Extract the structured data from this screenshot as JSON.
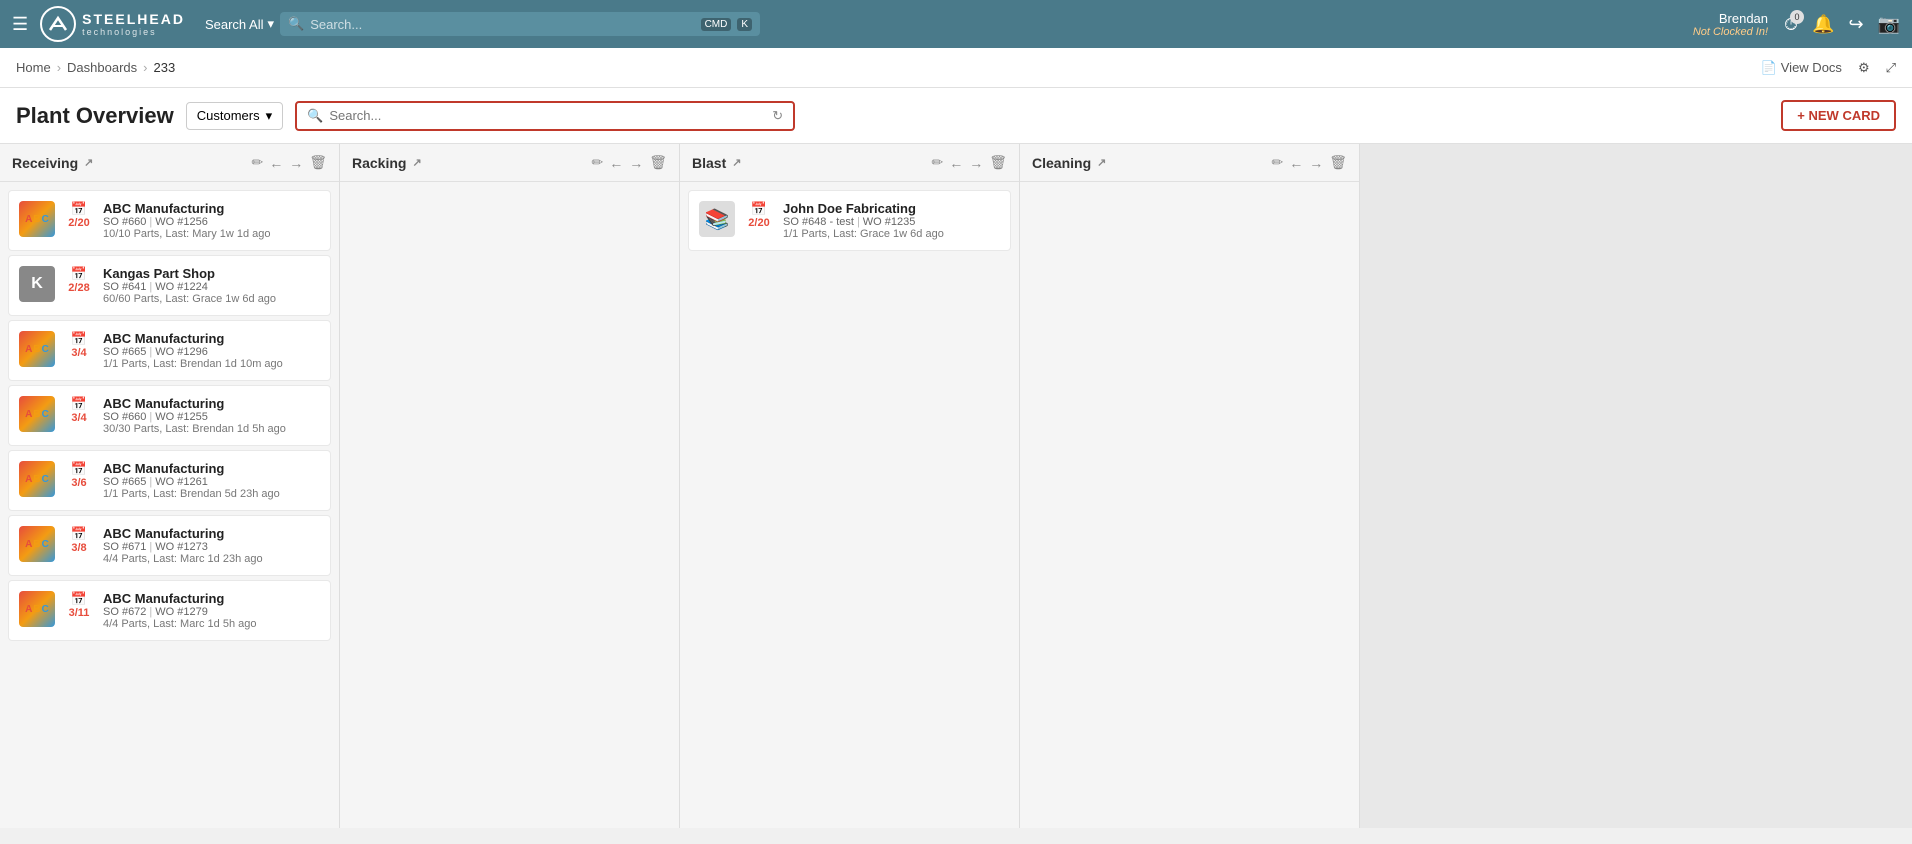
{
  "topnav": {
    "logo_text": "STEELHEAD",
    "logo_sub": "technologies",
    "search_all_label": "Search All",
    "search_placeholder": "Search...",
    "kbd1": "CMD",
    "kbd2": "K",
    "user_name": "Brendan",
    "user_status": "Not Clocked In!",
    "timer_badge": "0"
  },
  "breadcrumb": {
    "home": "Home",
    "sep1": "›",
    "dashboards": "Dashboards",
    "sep2": "›",
    "current": "233",
    "view_docs": "View Docs"
  },
  "toolbar": {
    "page_title": "Plant Overview",
    "customers_label": "Customers",
    "search_placeholder": "Search...",
    "new_card_label": "+ NEW CARD"
  },
  "columns": [
    {
      "id": "receiving",
      "title": "Receiving",
      "cards": [
        {
          "company": "ABC Manufacturing",
          "so": "SO #660",
          "wo": "WO #1256",
          "parts": "10/10 Parts, Last: Mary 1w 1d ago",
          "date": "2/20",
          "date_color": "red",
          "cal_color": "red",
          "avatar_type": "abc"
        },
        {
          "company": "Kangas Part Shop",
          "so": "SO #641",
          "wo": "WO #1224",
          "parts": "60/60 Parts, Last: Grace 1w 6d ago",
          "date": "2/28",
          "date_color": "red",
          "cal_color": "green",
          "avatar_type": "kps",
          "avatar_letter": "K"
        },
        {
          "company": "ABC Manufacturing",
          "so": "SO #665",
          "wo": "WO #1296",
          "parts": "1/1 Parts, Last: Brendan 1d 10m ago",
          "date": "3/4",
          "date_color": "red",
          "cal_color": "green",
          "avatar_type": "abc"
        },
        {
          "company": "ABC Manufacturing",
          "so": "SO #660",
          "wo": "WO #1255",
          "parts": "30/30 Parts, Last: Brendan 1d 5h ago",
          "date": "3/4",
          "date_color": "red",
          "cal_color": "green",
          "avatar_type": "abc"
        },
        {
          "company": "ABC Manufacturing",
          "so": "SO #665",
          "wo": "WO #1261",
          "parts": "1/1 Parts, Last: Brendan 5d 23h ago",
          "date": "3/6",
          "date_color": "red",
          "cal_color": "green",
          "avatar_type": "abc"
        },
        {
          "company": "ABC Manufacturing",
          "so": "SO #671",
          "wo": "WO #1273",
          "parts": "4/4 Parts, Last: Marc 1d 23h ago",
          "date": "3/8",
          "date_color": "red",
          "cal_color": "green",
          "avatar_type": "abc"
        },
        {
          "company": "ABC Manufacturing",
          "so": "SO #672",
          "wo": "WO #1279",
          "parts": "4/4 Parts, Last: Marc 1d 5h ago",
          "date": "3/11",
          "date_color": "red",
          "cal_color": "green",
          "avatar_type": "abc"
        }
      ]
    },
    {
      "id": "racking",
      "title": "Racking",
      "cards": []
    },
    {
      "id": "blast",
      "title": "Blast",
      "cards": [
        {
          "company": "John Doe Fabricating",
          "so": "SO #648 - test",
          "wo": "WO #1235",
          "parts": "1/1 Parts, Last: Grace 1w 6d ago",
          "date": "2/20",
          "date_color": "red",
          "cal_color": "red",
          "avatar_type": "img"
        }
      ]
    },
    {
      "id": "cleaning",
      "title": "Cleaning",
      "cards": []
    }
  ]
}
